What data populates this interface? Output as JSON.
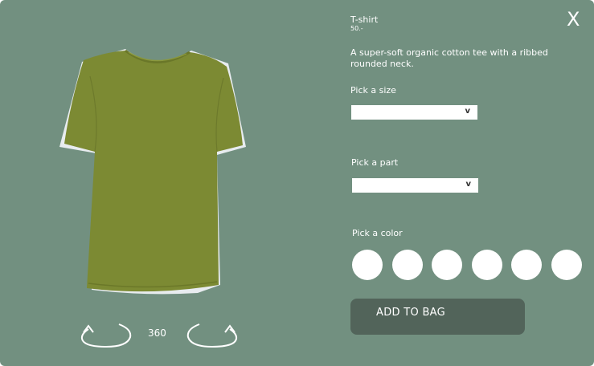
{
  "product": {
    "name": "T-shirt",
    "price": "50.-",
    "description": "A super-soft organic cotton tee with a ribbed rounded neck.",
    "shirt_color": "#7c8a33"
  },
  "close": {
    "label": "X"
  },
  "viewer": {
    "rotate_label": "360"
  },
  "size": {
    "label": "Pick a size",
    "value": "",
    "chevron": "v"
  },
  "part": {
    "label": "Pick a part",
    "value": "",
    "chevron": "v"
  },
  "color": {
    "label": "Pick a color",
    "swatches": [
      "#ffffff",
      "#ffffff",
      "#ffffff",
      "#ffffff",
      "#ffffff",
      "#ffffff"
    ]
  },
  "cart": {
    "add_label": "ADD TO BAG"
  },
  "theme": {
    "background": "#729080",
    "button": "#52645a"
  }
}
